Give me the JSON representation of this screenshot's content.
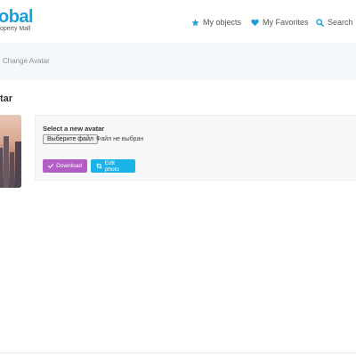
{
  "header": {
    "logo_text": "obal",
    "logo_sub": "operty Mall",
    "nav": [
      {
        "label": "My objects",
        "icon": "star-icon"
      },
      {
        "label": "My Favorites",
        "icon": "heart-icon"
      },
      {
        "label": "Search",
        "icon": "search-icon"
      }
    ]
  },
  "breadcrumb": {
    "current": "Change Avatar"
  },
  "page": {
    "title": "tar"
  },
  "upload": {
    "label": "Select a new avatar",
    "file_button": "Выберите файл",
    "file_status": "Файл не выбран"
  },
  "actions": {
    "download_label": "Download",
    "edit_label": "Edit photo"
  },
  "colors": {
    "brand": "#1a9fd9",
    "download": "#b25ec4",
    "edit": "#19b3ea",
    "crumb_bg": "#f3f9fb"
  }
}
